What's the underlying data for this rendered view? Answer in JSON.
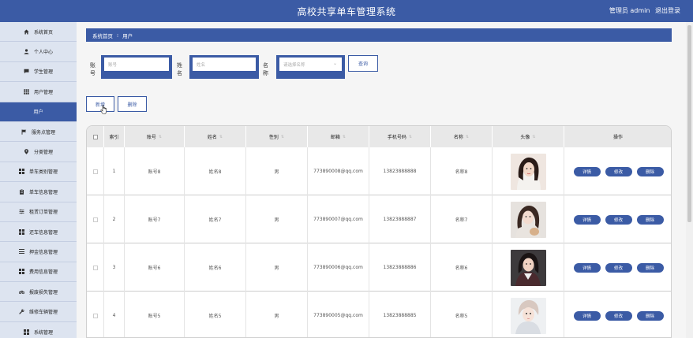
{
  "header": {
    "title": "高校共享单车管理系统",
    "user_label": "管理员 admin",
    "logout_label": "退出登录"
  },
  "sidebar": {
    "items": [
      {
        "label": "系统首页",
        "icon": "home-icon"
      },
      {
        "label": "个人中心",
        "icon": "user-icon"
      },
      {
        "label": "学生管理",
        "icon": "chat-icon"
      },
      {
        "label": "用户管理",
        "icon": "grid-icon"
      },
      {
        "label": "用户",
        "icon": "",
        "active": true
      },
      {
        "label": "服务点管理",
        "icon": "flag-icon"
      },
      {
        "label": "分类管理",
        "icon": "pin-icon"
      },
      {
        "label": "单车类别管理",
        "icon": "grid-icon"
      },
      {
        "label": "单车信息管理",
        "icon": "clipboard-icon"
      },
      {
        "label": "租赁订单管理",
        "icon": "sliders-icon"
      },
      {
        "label": "还车信息管理",
        "icon": "grid-icon"
      },
      {
        "label": "押金信息管理",
        "icon": "list-icon"
      },
      {
        "label": "费用信息管理",
        "icon": "grid-icon"
      },
      {
        "label": "报废损失管理",
        "icon": "bike-icon"
      },
      {
        "label": "维修车辆管理",
        "icon": "wrench-icon"
      },
      {
        "label": "系统管理",
        "icon": "grid-icon"
      }
    ]
  },
  "breadcrumb": {
    "home": "系统首页",
    "separator": "⁝",
    "current": "用户"
  },
  "search": {
    "account_label": "账号",
    "account_placeholder": "账号",
    "name_label": "姓名",
    "name_placeholder": "姓名",
    "title_label": "名称",
    "title_placeholder": "请选择名称",
    "query_label": "查询"
  },
  "actions": {
    "add_label": "新增",
    "delete_label": "删除"
  },
  "table": {
    "headers": [
      "",
      "索引",
      "账号",
      "姓名",
      "性别",
      "邮箱",
      "手机号码",
      "名称",
      "头像",
      "操作"
    ],
    "rows": [
      {
        "index": "1",
        "account": "账号8",
        "name": "姓名8",
        "gender": "男",
        "email": "773890008@qq.com",
        "phone": "13823888888",
        "title": "名称8"
      },
      {
        "index": "2",
        "account": "账号7",
        "name": "姓名7",
        "gender": "男",
        "email": "773890007@qq.com",
        "phone": "13823888887",
        "title": "名称7"
      },
      {
        "index": "3",
        "account": "账号6",
        "name": "姓名6",
        "gender": "男",
        "email": "773890006@qq.com",
        "phone": "13823888886",
        "title": "名称6"
      },
      {
        "index": "4",
        "account": "账号5",
        "name": "姓名5",
        "gender": "男",
        "email": "773890005@qq.com",
        "phone": "13823888885",
        "title": "名称5"
      }
    ],
    "op_labels": {
      "detail": "详情",
      "edit": "修改",
      "delete": "删除"
    }
  },
  "colors": {
    "primary": "#3b5ba5",
    "sidebar_bg": "#dde4f0",
    "page_bg": "#f5f5f5"
  }
}
